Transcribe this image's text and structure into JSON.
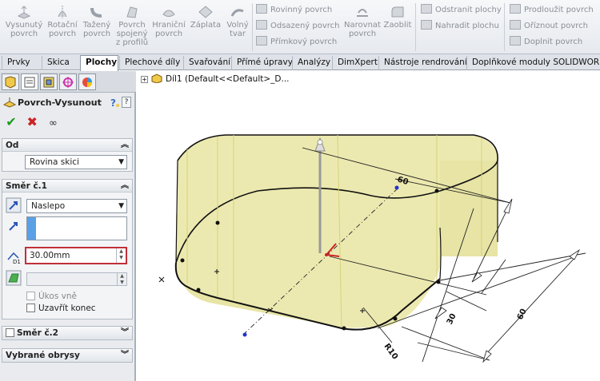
{
  "ribbon": {
    "big_buttons": [
      {
        "line1": "Vysunutý",
        "line2": "povrch",
        "line3": ""
      },
      {
        "line1": "Rotační",
        "line2": "povrch",
        "line3": ""
      },
      {
        "line1": "Tažený",
        "line2": "povrch",
        "line3": ""
      },
      {
        "line1": "Povrch",
        "line2": "spojený",
        "line3": "z profilů"
      },
      {
        "line1": "Hraniční",
        "line2": "povrch",
        "line3": ""
      },
      {
        "line1": "Záplata",
        "line2": "",
        "line3": ""
      },
      {
        "line1": "Volný",
        "line2": "tvar",
        "line3": ""
      }
    ],
    "small_buttons_col1": [
      "Rovinný povrch",
      "Odsazený povrch",
      "Přímkový povrch"
    ],
    "big_buttons_2": [
      {
        "line1": "Narovnat",
        "line2": "povrch"
      },
      {
        "line1": "Zaoblit",
        "line2": ""
      }
    ],
    "small_buttons_col2": [
      "Odstranit plochy",
      "Nahradit plochu"
    ],
    "small_buttons_col3": [
      "Prodloužit povrch",
      "Oříznout povrch",
      "Doplnit povrch"
    ]
  },
  "tabs": [
    "Prvky",
    "Skica",
    "Plochy",
    "Plechové díly",
    "Svařování",
    "Přímé úpravy",
    "Analýzy",
    "DimXpert",
    "Nástroje rendrování",
    "Doplňkové moduly SOLIDWORKS"
  ],
  "active_tab": "Plochy",
  "feature": {
    "title": "Povrch-Vysunout",
    "ok_icon": "check-icon",
    "cancel_icon": "x-icon",
    "preview_icon": "glasses-icon"
  },
  "od": {
    "header": "Od",
    "value": "Rovina skici"
  },
  "direction1": {
    "header": "Směr č.1",
    "end_condition": "Naslepo",
    "depth": "30.00mm",
    "draft_outward": "Úkos vně",
    "cap_end": "Uzavřít konec"
  },
  "direction2": {
    "header": "Směr č.2"
  },
  "contours": {
    "header": "Vybrané obrysy"
  },
  "tree": {
    "part": "Díl1  (Default<<Default>_D..."
  },
  "dimensions": {
    "d60_top": "60",
    "d60_right": "60",
    "d30": "30",
    "r10": "R10"
  },
  "colors": {
    "surface": "#ece9b0",
    "surface_edge": "#d6d27a",
    "accent_red": "#cc2222",
    "panel": "#e9ebee"
  }
}
